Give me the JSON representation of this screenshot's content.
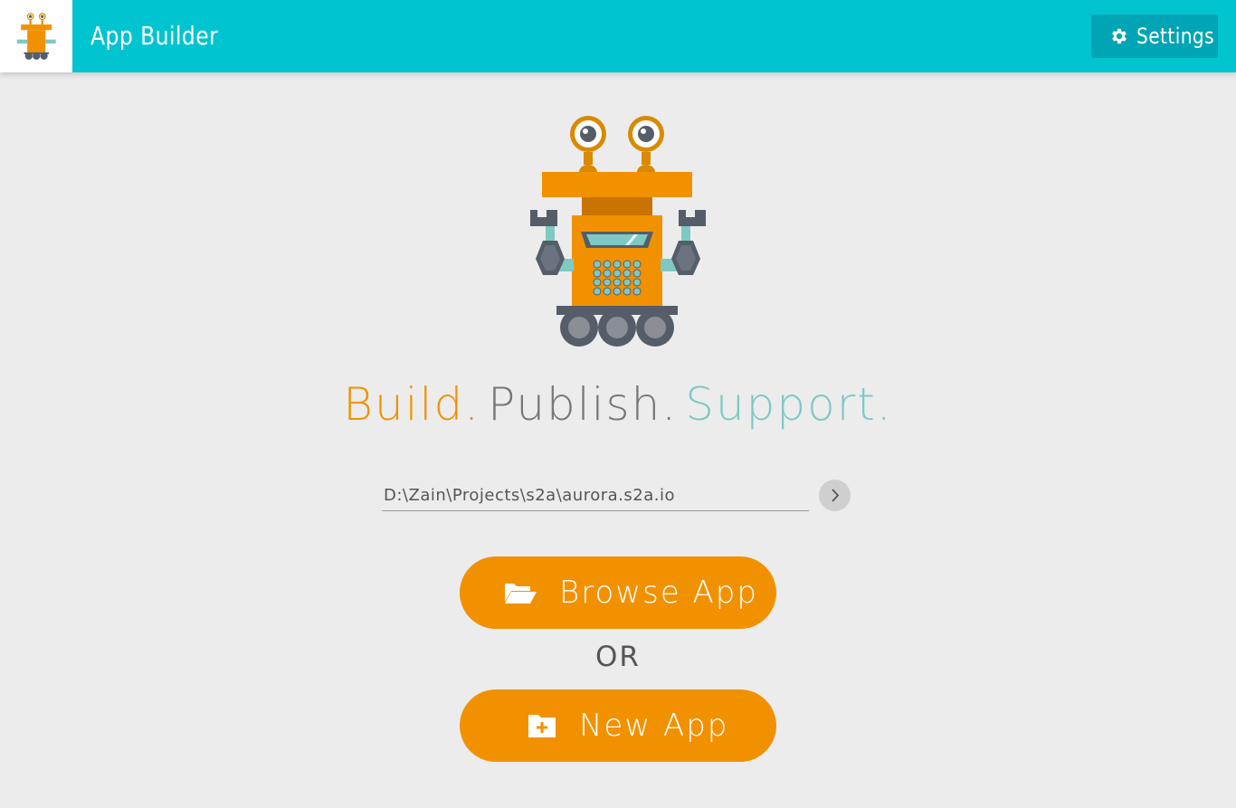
{
  "header": {
    "logo_name": "robot-logo",
    "title": "App Builder",
    "settings_label": "Settings",
    "settings_icon": "gear-icon",
    "bar_color": "#00c4d0",
    "settings_bg": "#00a5b5"
  },
  "hero": {
    "image": "robot-illustration",
    "tagline": {
      "build": "Build.",
      "publish": "Publish.",
      "support": "Support."
    },
    "colors": {
      "build": "#f09200",
      "publish": "#777777",
      "support": "#7ec9c3"
    }
  },
  "path": {
    "value": "D:\\Zain\\Projects\\s2a\\aurora.s2a.io",
    "go_icon": "chevron-right-icon"
  },
  "actions": {
    "browse_label": "Browse App",
    "browse_icon": "folder-open-icon",
    "or_label": "OR",
    "new_label": "New App",
    "new_icon": "folder-plus-icon",
    "button_color": "#f29100"
  }
}
